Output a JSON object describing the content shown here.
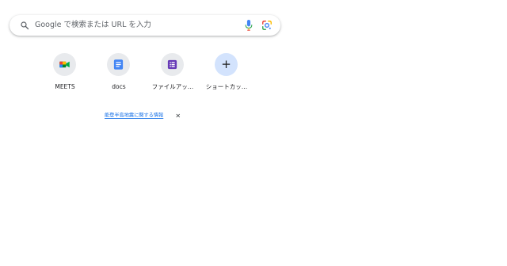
{
  "search": {
    "placeholder": "Google で検索または URL を入力"
  },
  "shortcuts": [
    {
      "label": "MEETS",
      "icon": "google-meet-icon"
    },
    {
      "label": "docs",
      "icon": "google-docs-icon"
    },
    {
      "label": "ファイルアッ…",
      "icon": "google-forms-icon"
    },
    {
      "label": "ショートカッ…",
      "icon": "plus-icon"
    }
  ],
  "notice": {
    "link_text": "能登半島地震に関する情報",
    "close_glyph": "✕"
  },
  "colors": {
    "link": "#1a73e8",
    "tile_bg": "#e8eaed",
    "add_tile_bg": "#d3e3fd"
  }
}
